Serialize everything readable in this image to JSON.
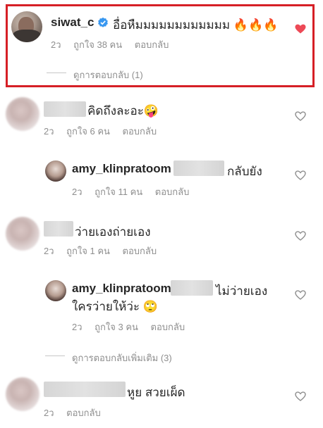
{
  "comments": [
    {
      "username": "siwat_c",
      "text": "อื่อหืมมมมมมมมมมมม 🔥🔥🔥",
      "time": "2ว",
      "likes": "ถูกใจ 38 คน",
      "reply": "ตอบกลับ",
      "view_replies": "ดูการตอบกลับ (1)",
      "liked_color": "#ed4956"
    },
    {
      "text": "คิดถึงละอะ🤪",
      "time": "2ว",
      "likes": "ถูกใจ 6 คน",
      "reply": "ตอบกลับ"
    },
    {
      "username": "amy_klinpratoom",
      "text": "กลับยัง",
      "time": "2ว",
      "likes": "ถูกใจ 11 คน",
      "reply": "ตอบกลับ"
    },
    {
      "text": "ว่ายเองถ่ายเอง",
      "time": "2ว",
      "likes": "ถูกใจ 1 คน",
      "reply": "ตอบกลับ"
    },
    {
      "username": "amy_klinpratoom",
      "text": "ไม่ว่ายเอง",
      "text2": "ใครว่ายให้ว่ะ 🙄",
      "time": "2ว",
      "likes": "ถูกใจ 3 คน",
      "reply": "ตอบกลับ",
      "view_replies": "ดูการตอบกลับเพิ่มเติม (3)"
    },
    {
      "text": "หูย สวยเผ็ด",
      "time": "2ว",
      "reply": "ตอบกลับ"
    }
  ],
  "highlight_color": "#d61f26",
  "heart_outline_color": "#8e8e8e"
}
